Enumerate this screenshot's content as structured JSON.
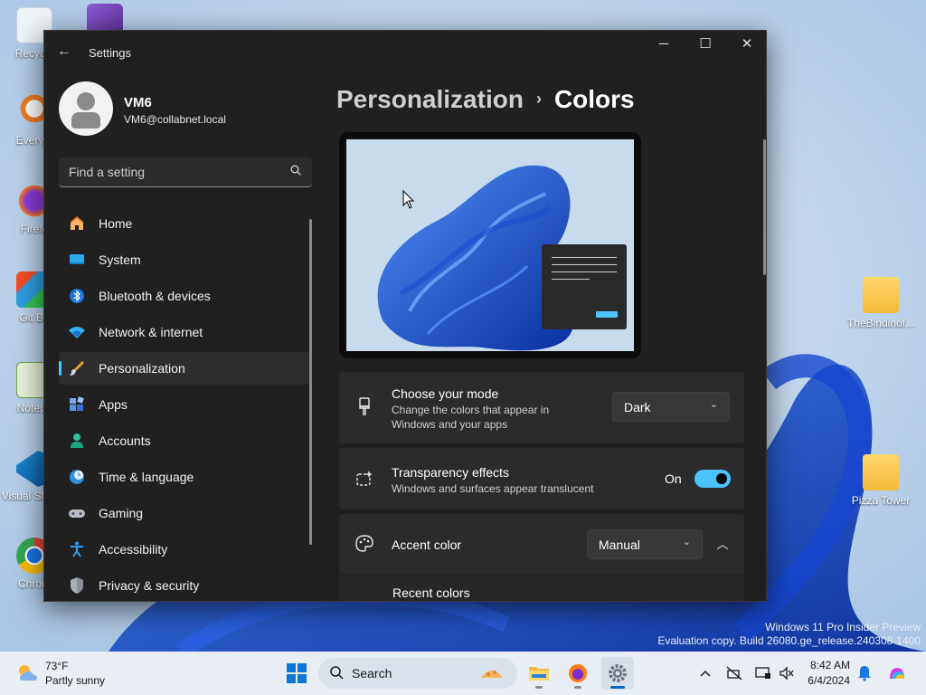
{
  "window": {
    "title": "Settings",
    "back_label": "←",
    "minimize_label": "─",
    "maximize_label": "☐",
    "close_label": "✕"
  },
  "profile": {
    "name": "VM6",
    "email": "VM6@collabnet.local"
  },
  "search": {
    "placeholder": "Find a setting",
    "icon": "search-icon"
  },
  "sidebar": {
    "items": [
      {
        "label": "Home",
        "icon": "home-icon",
        "active": false
      },
      {
        "label": "System",
        "icon": "system-icon",
        "active": false
      },
      {
        "label": "Bluetooth & devices",
        "icon": "bluetooth-icon",
        "active": false
      },
      {
        "label": "Network & internet",
        "icon": "wifi-icon",
        "active": false
      },
      {
        "label": "Personalization",
        "icon": "brush-icon",
        "active": true
      },
      {
        "label": "Apps",
        "icon": "apps-icon",
        "active": false
      },
      {
        "label": "Accounts",
        "icon": "person-icon",
        "active": false
      },
      {
        "label": "Time & language",
        "icon": "globe-clock-icon",
        "active": false
      },
      {
        "label": "Gaming",
        "icon": "gamepad-icon",
        "active": false
      },
      {
        "label": "Accessibility",
        "icon": "accessibility-icon",
        "active": false
      },
      {
        "label": "Privacy & security",
        "icon": "shield-icon",
        "active": false
      }
    ]
  },
  "breadcrumb": {
    "parent": "Personalization",
    "separator": "›",
    "current": "Colors"
  },
  "settings": {
    "mode": {
      "title": "Choose your mode",
      "subtitle": "Change the colors that appear in Windows and your apps",
      "value": "Dark",
      "icon": "brush-mode-icon"
    },
    "transparency": {
      "title": "Transparency effects",
      "subtitle": "Windows and surfaces appear translucent",
      "toggle_label": "On",
      "enabled": true,
      "icon": "sparkle-icon"
    },
    "accent": {
      "title": "Accent color",
      "value": "Manual",
      "expanded": true,
      "icon": "palette-icon",
      "recent_colors_label": "Recent colors"
    }
  },
  "desktop": {
    "icons": [
      {
        "label": "Recycle",
        "icon": "recycle-bin-icon"
      },
      {
        "label": "Everyth",
        "icon": "everything-search-icon"
      },
      {
        "label": "Firefo",
        "icon": "firefox-icon"
      },
      {
        "label": "Git Ba",
        "icon": "git-bash-icon"
      },
      {
        "label": "Notepa",
        "icon": "notepad-icon"
      },
      {
        "label": "Visual St Cod",
        "icon": "vscode-icon"
      },
      {
        "label": "Chrom",
        "icon": "chrome-icon"
      },
      {
        "label": "TheBindinof...",
        "icon": "folder-icon"
      },
      {
        "label": "Pizza Tower",
        "icon": "folder-icon"
      }
    ],
    "watermark_line1": "Windows 11 Pro Insider Preview",
    "watermark_line2": "Evaluation copy. Build 26080.ge_release.240308-1400"
  },
  "taskbar": {
    "weather_temp": "73°F",
    "weather_desc": "Partly sunny",
    "search_label": "Search",
    "time": "8:42 AM",
    "date": "6/4/2024",
    "apps": [
      {
        "name": "start-button",
        "icon": "windows-logo-icon"
      },
      {
        "name": "file-explorer",
        "icon": "folder-icon"
      },
      {
        "name": "firefox",
        "icon": "firefox-icon"
      },
      {
        "name": "settings",
        "icon": "gear-icon",
        "active": true
      }
    ],
    "tray": [
      "chevron-up-icon",
      "network-off-icon",
      "screen-icon",
      "volume-mute-icon",
      "notification-bell-icon",
      "copilot-icon"
    ]
  },
  "colors": {
    "accent": "#4cc2ff",
    "window_bg": "#202020",
    "card_bg": "#2b2b2b"
  }
}
